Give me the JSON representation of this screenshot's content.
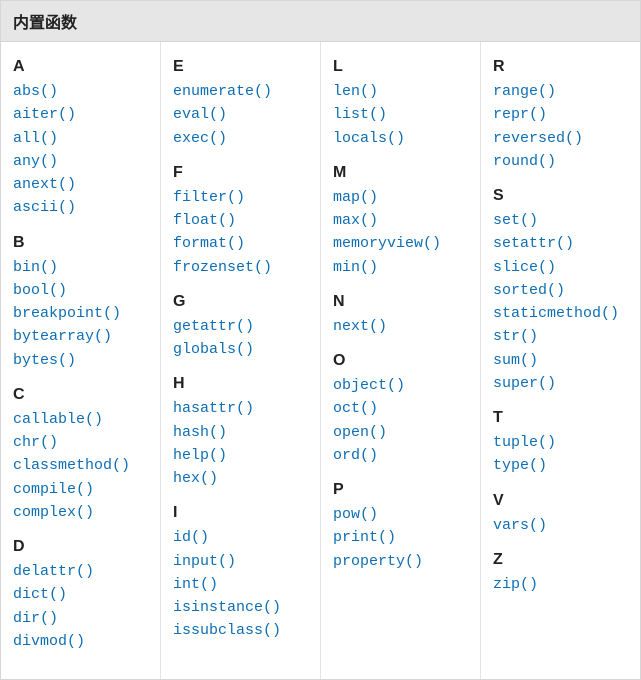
{
  "header": {
    "title": "内置函数"
  },
  "columns": [
    [
      {
        "letter": "A",
        "items": [
          "abs()",
          "aiter()",
          "all()",
          "any()",
          "anext()",
          "ascii()"
        ]
      },
      {
        "letter": "B",
        "items": [
          "bin()",
          "bool()",
          "breakpoint()",
          "bytearray()",
          "bytes()"
        ]
      },
      {
        "letter": "C",
        "items": [
          "callable()",
          "chr()",
          "classmethod()",
          "compile()",
          "complex()"
        ]
      },
      {
        "letter": "D",
        "items": [
          "delattr()",
          "dict()",
          "dir()",
          "divmod()"
        ]
      }
    ],
    [
      {
        "letter": "E",
        "items": [
          "enumerate()",
          "eval()",
          "exec()"
        ]
      },
      {
        "letter": "F",
        "items": [
          "filter()",
          "float()",
          "format()",
          "frozenset()"
        ]
      },
      {
        "letter": "G",
        "items": [
          "getattr()",
          "globals()"
        ]
      },
      {
        "letter": "H",
        "items": [
          "hasattr()",
          "hash()",
          "help()",
          "hex()"
        ]
      },
      {
        "letter": "I",
        "items": [
          "id()",
          "input()",
          "int()",
          "isinstance()",
          "issubclass()"
        ]
      }
    ],
    [
      {
        "letter": "L",
        "items": [
          "len()",
          "list()",
          "locals()"
        ]
      },
      {
        "letter": "M",
        "items": [
          "map()",
          "max()",
          "memoryview()",
          "min()"
        ]
      },
      {
        "letter": "N",
        "items": [
          "next()"
        ]
      },
      {
        "letter": "O",
        "items": [
          "object()",
          "oct()",
          "open()",
          "ord()"
        ]
      },
      {
        "letter": "P",
        "items": [
          "pow()",
          "print()",
          "property()"
        ]
      }
    ],
    [
      {
        "letter": "R",
        "items": [
          "range()",
          "repr()",
          "reversed()",
          "round()"
        ]
      },
      {
        "letter": "S",
        "items": [
          "set()",
          "setattr()",
          "slice()",
          "sorted()",
          "staticmethod()",
          "str()",
          "sum()",
          "super()"
        ]
      },
      {
        "letter": "T",
        "items": [
          "tuple()",
          "type()"
        ]
      },
      {
        "letter": "V",
        "items": [
          "vars()"
        ]
      },
      {
        "letter": "Z",
        "items": [
          "zip()"
        ]
      }
    ]
  ]
}
